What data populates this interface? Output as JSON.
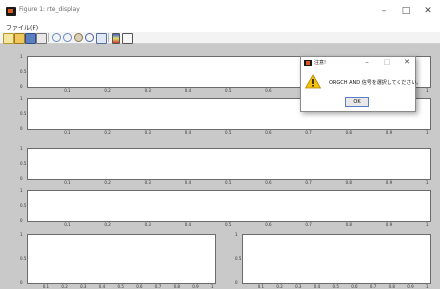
{
  "window": {
    "title": "Figure 1: rte_display",
    "minimize": "–",
    "maximize": "□",
    "close": "✕"
  },
  "menu": {
    "items": [
      "ファイル(F)"
    ]
  },
  "toolbar": {
    "buttons": [
      "new-icon",
      "open-icon",
      "save-icon",
      "print-icon",
      "zoom-in-icon",
      "zoom-out-icon",
      "pan-icon",
      "rotate-icon",
      "data-cursor-icon",
      "colorbar-icon",
      "legend-icon"
    ]
  },
  "axes": {
    "full_width_xticks": [
      "0.1",
      "0.2",
      "0.3",
      "0.4",
      "0.5",
      "0.6",
      "0.7",
      "0.8",
      "0.9",
      "1"
    ],
    "half_width_xticks": [
      "0.1",
      "0.2",
      "0.3",
      "0.4",
      "0.5",
      "0.6",
      "0.7",
      "0.8",
      "0.9",
      "1"
    ],
    "yticks": [
      "1",
      "0.5",
      "0"
    ]
  },
  "dialog": {
    "title": "注意!",
    "message": "ORGCH AND 信号を選択してください。",
    "ok_label": "OK",
    "minimize": "–",
    "maximize": "□",
    "close": "✕"
  },
  "colors": {
    "figure_bg": "#c9c9c9",
    "axes_bg": "#ffffff",
    "warning_yellow": "#f4c20d",
    "matlab_orange": "#d8581e"
  }
}
